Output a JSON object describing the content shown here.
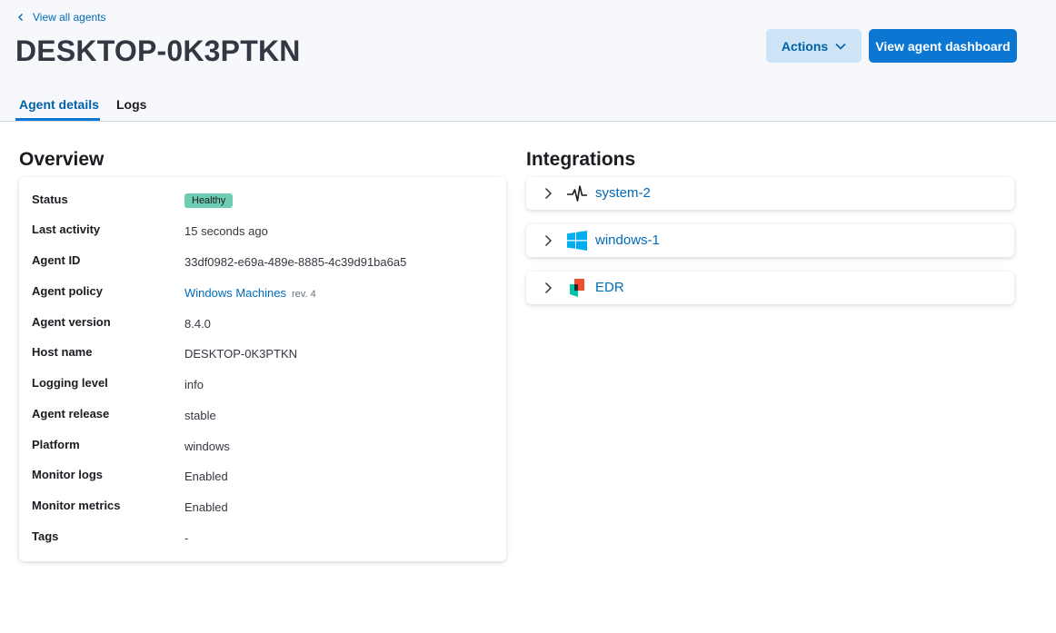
{
  "header": {
    "back_label": "View all agents",
    "title": "DESKTOP-0K3PTKN",
    "actions_label": "Actions",
    "dashboard_label": "View agent dashboard"
  },
  "tabs": [
    {
      "label": "Agent details",
      "selected": true
    },
    {
      "label": "Logs",
      "selected": false
    }
  ],
  "overview": {
    "title": "Overview",
    "rows": [
      {
        "label": "Status",
        "value": "Healthy"
      },
      {
        "label": "Last activity",
        "value": "15 seconds ago"
      },
      {
        "label": "Agent ID",
        "value": "33df0982-e69a-489e-8885-4c39d91ba6a5"
      },
      {
        "label": "Agent policy",
        "value": "Windows Machines",
        "extra": "rev. 4"
      },
      {
        "label": "Agent version",
        "value": "8.4.0"
      },
      {
        "label": "Host name",
        "value": "DESKTOP-0K3PTKN"
      },
      {
        "label": "Logging level",
        "value": "info"
      },
      {
        "label": "Agent release",
        "value": "stable"
      },
      {
        "label": "Platform",
        "value": "windows"
      },
      {
        "label": "Monitor logs",
        "value": "Enabled"
      },
      {
        "label": "Monitor metrics",
        "value": "Enabled"
      },
      {
        "label": "Tags",
        "value": "-"
      }
    ]
  },
  "integrations": {
    "title": "Integrations",
    "items": [
      {
        "name": "system-2",
        "icon": "system-pulse-icon"
      },
      {
        "name": "windows-1",
        "icon": "windows-logo-icon"
      },
      {
        "name": "EDR",
        "icon": "edr-shield-icon"
      }
    ]
  },
  "colors": {
    "accent": "#0b77d2",
    "link": "#006bb8",
    "healthy": "#6dccb1"
  }
}
